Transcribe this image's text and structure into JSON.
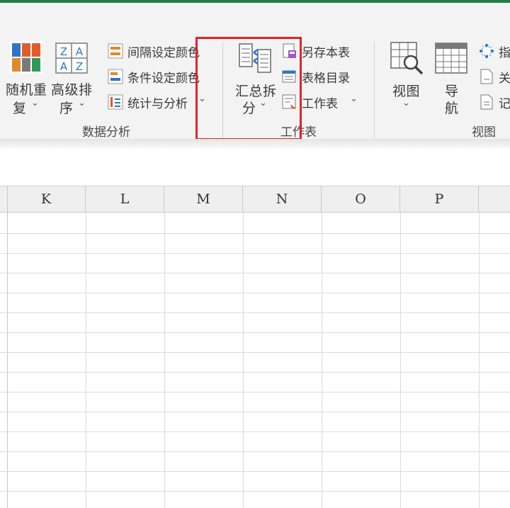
{
  "ribbon": {
    "random_sort": {
      "line1": "随机重",
      "line2": "复"
    },
    "advanced_sort": {
      "line1": "高级排",
      "line2": "序"
    },
    "interval_color": "间隔设定颜色",
    "condition_color": "条件设定颜色",
    "stats_analysis": "统计与分析",
    "group_data_analysis": "数据分析",
    "summary_split": {
      "line1": "汇总拆",
      "line2": "分"
    },
    "save_as_table": "另存本表",
    "table_directory": "表格目录",
    "worksheet": "工作表",
    "group_worksheet": "工作表",
    "view_btn": "视图",
    "nav_btn": {
      "line1": "导",
      "line2": "航"
    },
    "partial_items": [
      "指",
      "关",
      "记"
    ],
    "group_view": "视图",
    "dropdown_glyph": "⌄"
  },
  "grid": {
    "columns": [
      "K",
      "L",
      "M",
      "N",
      "O",
      "P"
    ]
  },
  "colors": {
    "highlight_box": "#e0242a",
    "accent_green": "#1f7f45"
  }
}
